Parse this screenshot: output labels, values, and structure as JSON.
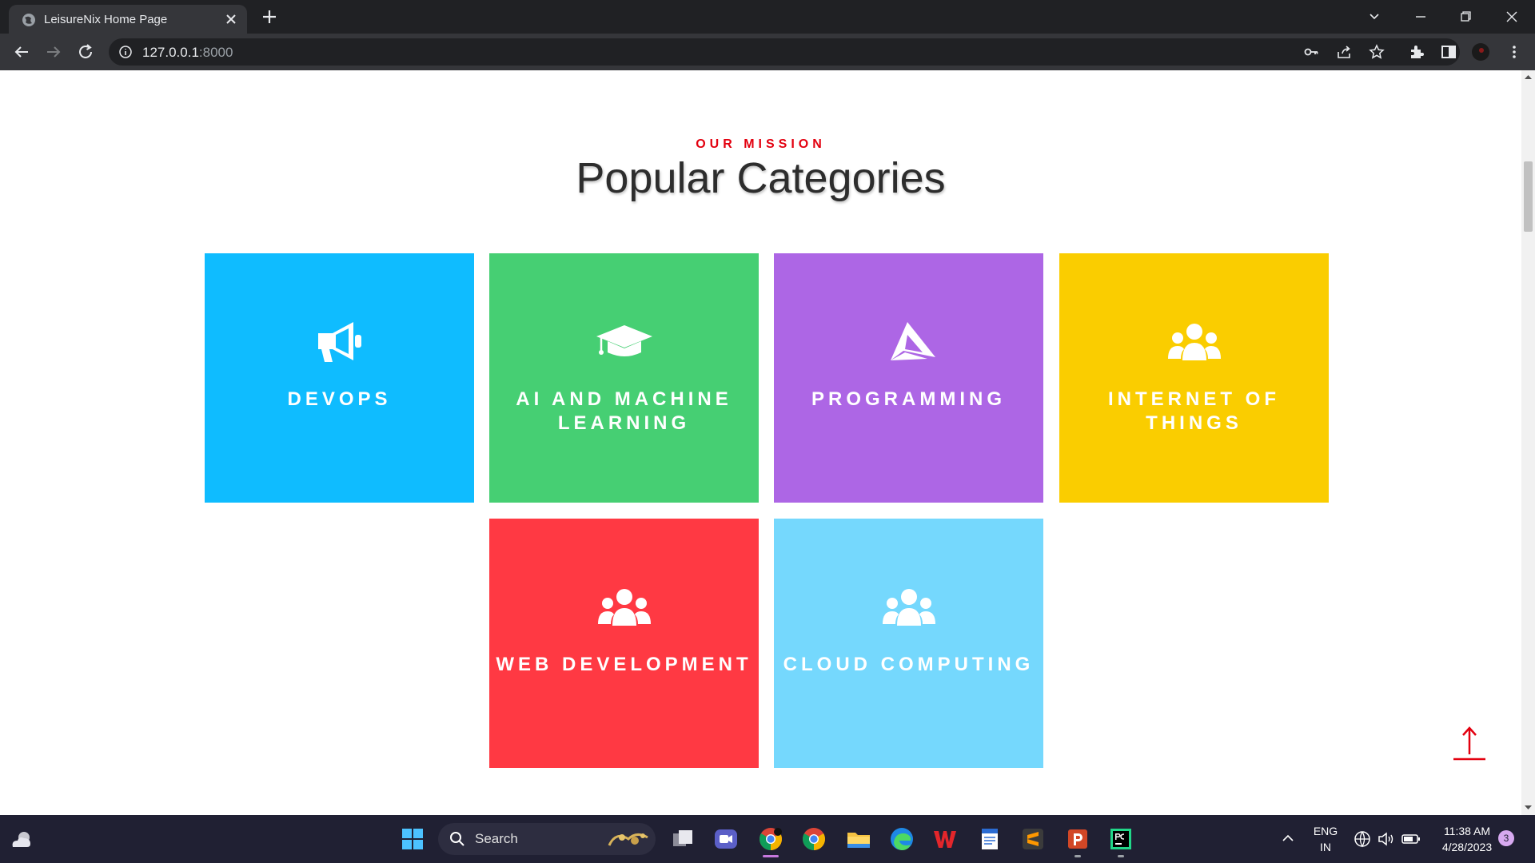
{
  "browser": {
    "tab_title": "LeisureNix Home Page",
    "url_host": "127.0.0.1",
    "url_port": ":8000"
  },
  "page": {
    "eyebrow": "OUR MISSION",
    "heading": "Popular Categories",
    "categories": [
      {
        "label": "DEVOPS",
        "color": "#0fbcff",
        "icon": "megaphone-icon"
      },
      {
        "label": "AI AND MACHINE LEARNING",
        "color": "#46cf73",
        "icon": "graduation-cap-icon"
      },
      {
        "label": "PROGRAMMING",
        "color": "#ad66e5",
        "icon": "paper-plane-icon"
      },
      {
        "label": "INTERNET OF THINGS",
        "color": "#facd00",
        "icon": "users-icon"
      },
      {
        "label": "WEB DEVELOPMENT",
        "color": "#ff3943",
        "icon": "users-icon"
      },
      {
        "label": "CLOUD COMPUTING",
        "color": "#75d8fd",
        "icon": "users-icon"
      }
    ],
    "scroll_top_icon": "arrow-up-icon",
    "accent_color": "#e3000f"
  },
  "taskbar": {
    "search_label": "Search",
    "language": "ENG",
    "region": "IN",
    "time": "11:38 AM",
    "date": "4/28/2023",
    "notification_count": "3"
  }
}
